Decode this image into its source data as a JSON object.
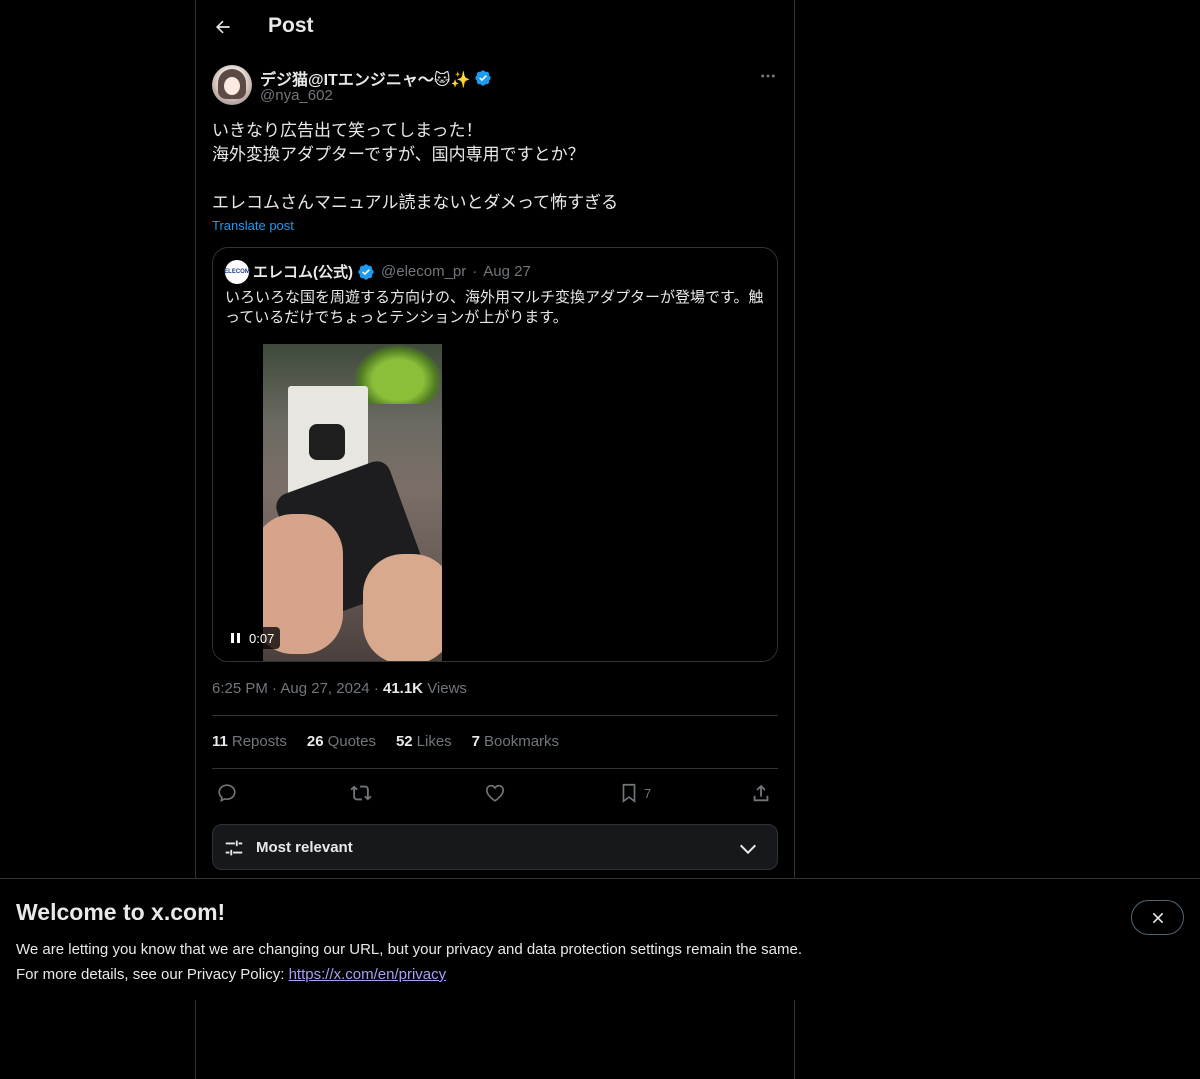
{
  "header": {
    "title": "Post"
  },
  "post": {
    "author_name": "デジ猫@ITエンジニャ〜🐱✨",
    "author_handle": "@nya_602",
    "text": "いきなり広告出て笑ってしまった！\n海外変換アダプターですが、国内専用ですとか？\n\nエレコムさんマニュアル読まないとダメって怖すぎる",
    "translate_label": "Translate post",
    "time": "6:25 PM",
    "date": "Aug 27, 2024",
    "views_count": "41.1K",
    "views_label": "Views"
  },
  "quote": {
    "avatar_text": "ELECOM",
    "name": "エレコム(公式)",
    "handle": "@elecom_pr",
    "date": "Aug 27",
    "text": "いろいろな国を周遊する方向けの、海外用マルチ変換アダプターが登場です。触っているだけでちょっとテンションが上がります。",
    "video_time": "0:07"
  },
  "stats": {
    "reposts_count": "11",
    "reposts_label": "Reposts",
    "quotes_count": "26",
    "quotes_label": "Quotes",
    "likes_count": "52",
    "likes_label": "Likes",
    "bookmarks_count": "7",
    "bookmarks_label": "Bookmarks"
  },
  "actions": {
    "bookmark_count": "7"
  },
  "sort": {
    "label": "Most relevant"
  },
  "banner": {
    "title": "Welcome to x.com!",
    "line1": "We are letting you know that we are changing our URL, but your privacy and data protection settings remain the same.",
    "line2_prefix": "For more details, see our Privacy Policy: ",
    "link": "https://x.com/en/privacy"
  },
  "colors": {
    "accent": "#1d9bf0",
    "muted": "#71767b",
    "border": "#2f3336",
    "link": "#a6a0f5"
  }
}
